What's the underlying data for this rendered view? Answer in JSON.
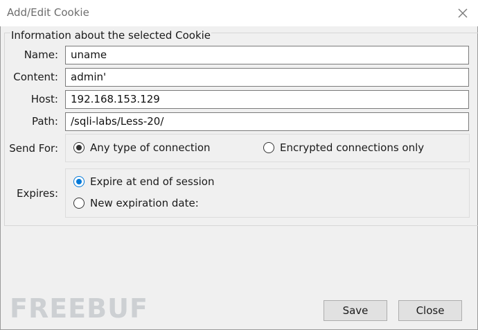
{
  "window": {
    "title": "Add/Edit Cookie",
    "close_icon": "close-icon"
  },
  "group": {
    "legend": "Information about the selected Cookie"
  },
  "fields": {
    "name_label": "Name:",
    "name_value": "uname",
    "content_label": "Content:",
    "content_value": "admin'",
    "host_label": "Host:",
    "host_value": "192.168.153.129",
    "path_label": "Path:",
    "path_value": "/sqli-labs/Less-20/"
  },
  "send_for": {
    "label": "Send For:",
    "options": [
      "Any type of connection",
      "Encrypted connections only"
    ],
    "selected": "Any type of connection"
  },
  "expires": {
    "label": "Expires:",
    "options": [
      "Expire at end of session",
      "New expiration date:"
    ],
    "selected": "Expire at end of session"
  },
  "buttons": {
    "save": "Save",
    "close": "Close"
  },
  "watermark": "FREEBUF",
  "colors": {
    "accent": "#0078d7",
    "background": "#f0f0f0"
  }
}
